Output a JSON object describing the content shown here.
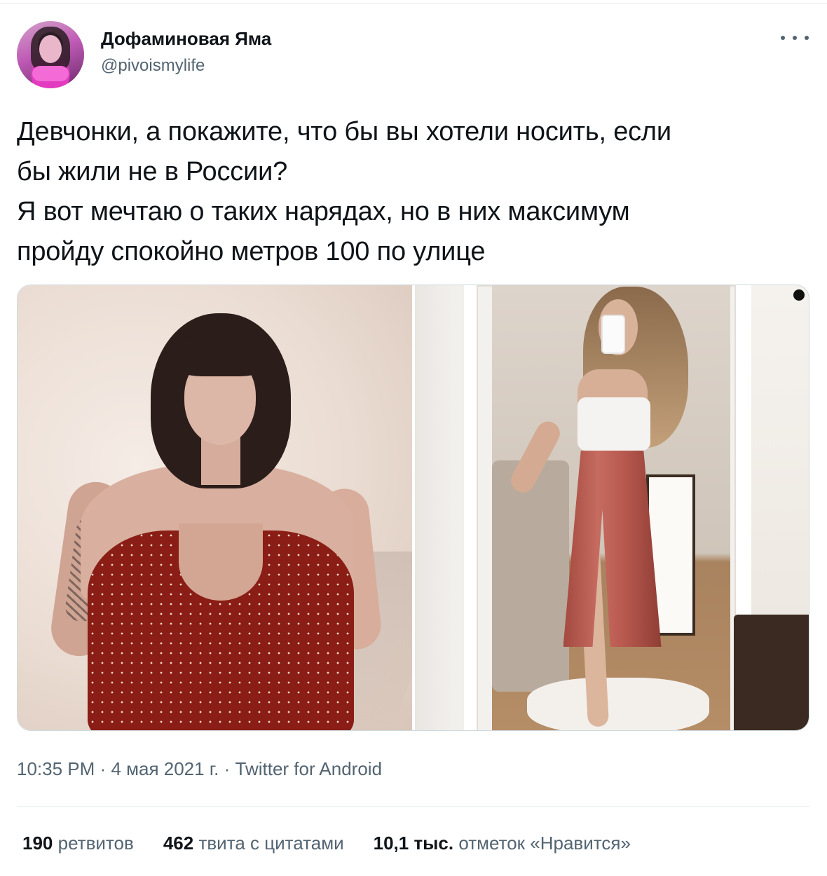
{
  "author": {
    "display_name": "Дофаминовая Яма",
    "handle": "@pivoismylife"
  },
  "tweet": {
    "text": "Девчонки, а покажите, что бы вы хотели носить, если\nбы жили не в России?\nЯ вот мечтаю о таких нарядах, но в них максимум\nпройду спокойно метров 100 по улице"
  },
  "meta": {
    "time": "10:35 PM",
    "separator": "·",
    "date": "4 мая 2021 г.",
    "source": "Twitter for Android"
  },
  "stats": {
    "retweets": {
      "count": "190",
      "label": "ретвитов"
    },
    "quotes": {
      "count": "462",
      "label": "твита с цитатами"
    },
    "likes": {
      "count": "10,1 тыс.",
      "label": "отметок «Нравится»"
    }
  },
  "colors": {
    "primary_text": "#0f1419",
    "secondary_text": "#536471",
    "divider": "#e6ecf0"
  }
}
